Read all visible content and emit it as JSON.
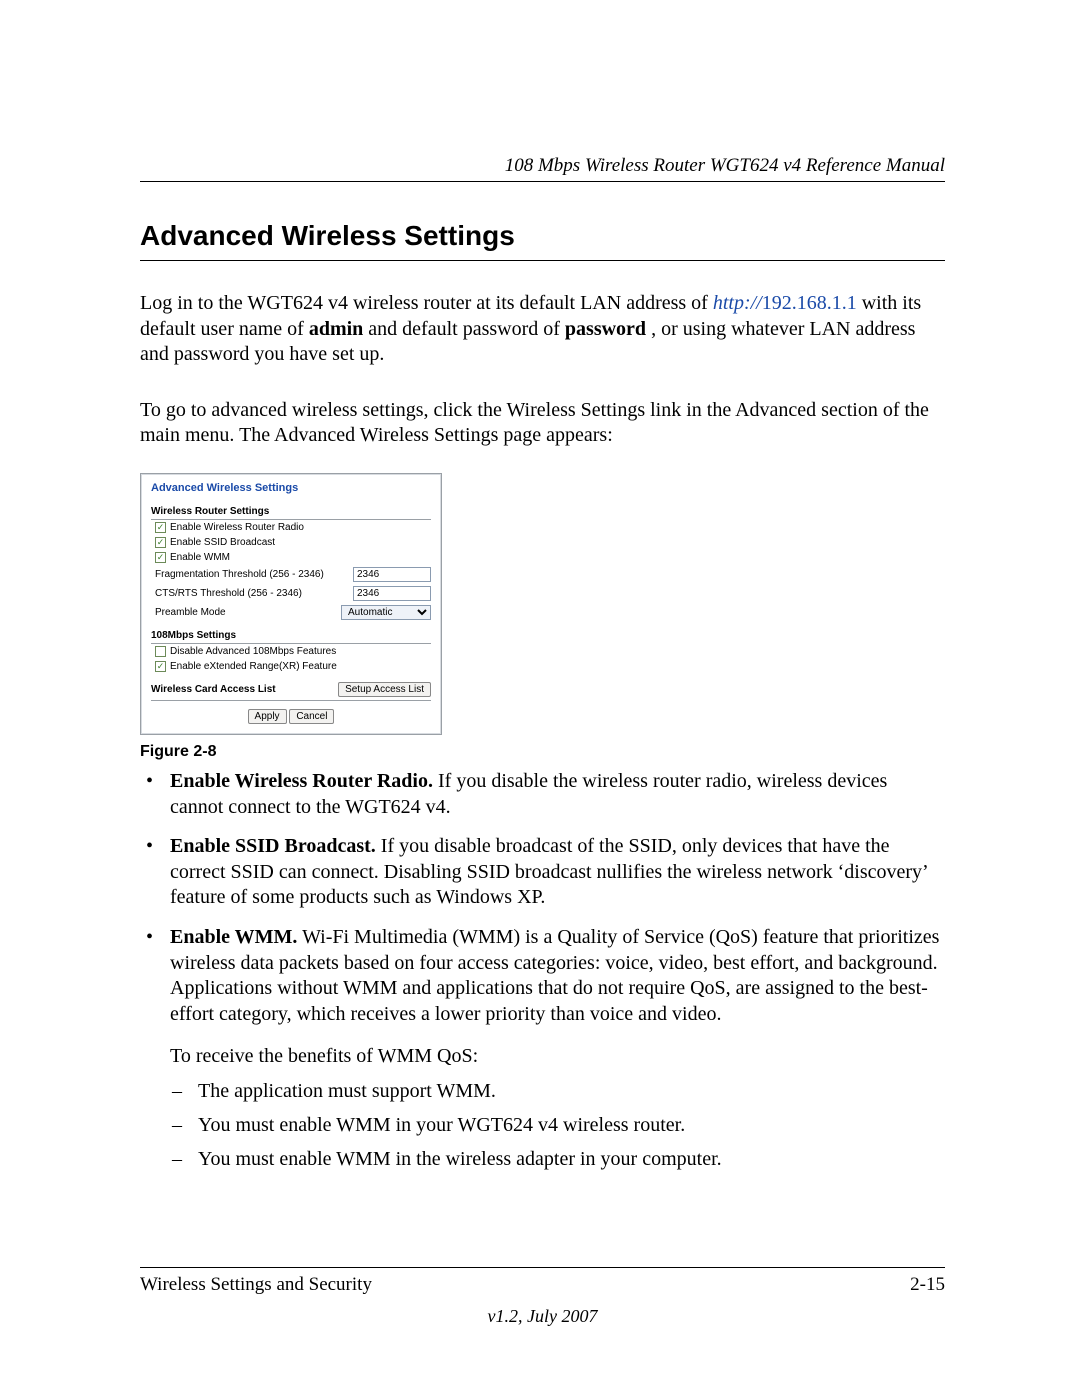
{
  "header": {
    "title": "108 Mbps Wireless Router WGT624 v4 Reference Manual"
  },
  "section": {
    "title": "Advanced Wireless Settings"
  },
  "intro": {
    "p1_a": "Log in to the WGT624 v4 wireless router at its default LAN address of ",
    "p1_link_scheme": "http://",
    "p1_link_host": "192.168.1.1",
    "p1_b": " with its default user name of ",
    "p1_admin": "admin",
    "p1_c": " and default password of ",
    "p1_password": "password",
    "p1_d": ", or using whatever LAN address and password you have set up.",
    "p2": "To go to advanced wireless settings, click the Wireless Settings link in the Advanced section of the main menu. The Advanced Wireless Settings page appears:"
  },
  "panel": {
    "title": "Advanced Wireless Settings",
    "group1": {
      "title": "Wireless Router Settings",
      "enable_radio": {
        "label": "Enable Wireless Router Radio",
        "checked": true
      },
      "enable_ssid": {
        "label": "Enable SSID Broadcast",
        "checked": true
      },
      "enable_wmm": {
        "label": "Enable WMM",
        "checked": true
      },
      "frag": {
        "label": "Fragmentation Threshold (256 - 2346)",
        "value": "2346"
      },
      "cts": {
        "label": "CTS/RTS Threshold (256 - 2346)",
        "value": "2346"
      },
      "preamble": {
        "label": "Preamble Mode",
        "value": "Automatic"
      }
    },
    "group2": {
      "title": "108Mbps Settings",
      "disable_108": {
        "label": "Disable Advanced 108Mbps Features",
        "checked": false
      },
      "enable_xr": {
        "label": "Enable eXtended Range(XR) Feature",
        "checked": true
      }
    },
    "access": {
      "label": "Wireless Card Access List",
      "button": "Setup Access List"
    },
    "buttons": {
      "apply": "Apply",
      "cancel": "Cancel"
    }
  },
  "figure": {
    "caption": "Figure 2-8"
  },
  "bullets": {
    "b1_bold": "Enable Wireless Router Radio.",
    "b1_rest": " If you disable the wireless router radio, wireless devices cannot connect to the WGT624 v4.",
    "b2_bold": "Enable SSID Broadcast.",
    "b2_rest": " If you disable broadcast of the SSID, only devices that have the correct SSID can connect. Disabling SSID broadcast nullifies the wireless network ‘discovery’ feature of some products such as Windows XP.",
    "b3_bold": "Enable WMM.",
    "b3_rest": " Wi-Fi Multimedia (WMM) is a Quality of Service (QoS) feature that prioritizes wireless data packets based on four access categories: voice, video, best effort, and background. Applications without WMM and applications that do not require QoS, are assigned to the best-effort category, which receives a lower priority than voice and video.",
    "b3_para": "To receive the benefits of WMM QoS:",
    "b3_d1": "The application must support WMM.",
    "b3_d2": "You must enable WMM in your WGT624 v4 wireless router.",
    "b3_d3": "You must enable WMM in the wireless adapter in your computer."
  },
  "footer": {
    "left": "Wireless Settings and Security",
    "right": "2-15",
    "version": "v1.2, July 2007"
  }
}
